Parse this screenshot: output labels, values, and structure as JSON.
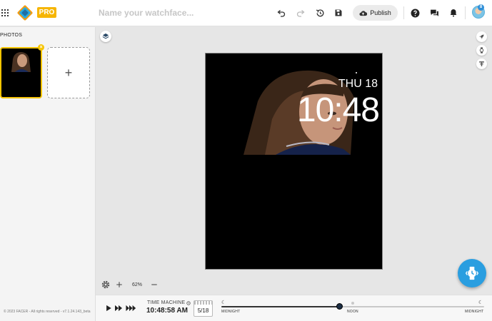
{
  "topbar": {
    "pro_badge": "PRO",
    "name_placeholder": "Name your watchface...",
    "publish_label": "Publish",
    "avatar_badge": "8"
  },
  "sidebar": {
    "photos_label": "PHOTOS",
    "add_photo_symbol": "+",
    "remove_photo_symbol": "×",
    "copyright": "© 2023 FACER - All rights reserved - v7.1.24.143_beta"
  },
  "watchface": {
    "date": "THU 18",
    "time": "10:48"
  },
  "zoom": {
    "level": "62%"
  },
  "time_machine": {
    "label": "TIME MACHINE",
    "time": "10:48:58 AM",
    "date": "5/18",
    "progress": 0.45,
    "ticks": [
      "MIDNIGHT",
      "NOON",
      "MIDNIGHT"
    ]
  },
  "icons": {
    "apps": "grid-icon",
    "undo": "undo-icon",
    "redo": "redo-icon",
    "history": "history-icon",
    "save": "save-icon",
    "publish": "cloud-upload-icon",
    "help": "help-icon",
    "chat": "chat-icon",
    "notifications": "bell-icon",
    "layers": "layers-icon",
    "rocket": "rocket-icon",
    "watch": "watch-icon",
    "tool": "tune-icon",
    "settings": "gear-icon",
    "zoom_in": "plus-icon",
    "zoom_out": "minus-icon",
    "play": "play-icon",
    "fast": "fast-forward-icon",
    "faster": "faster-forward-icon",
    "fab": "watch-face-icon"
  },
  "colors": {
    "accent": "#2a9ee0",
    "pro": "#f6b500",
    "selected_photo": "#f6c400"
  }
}
